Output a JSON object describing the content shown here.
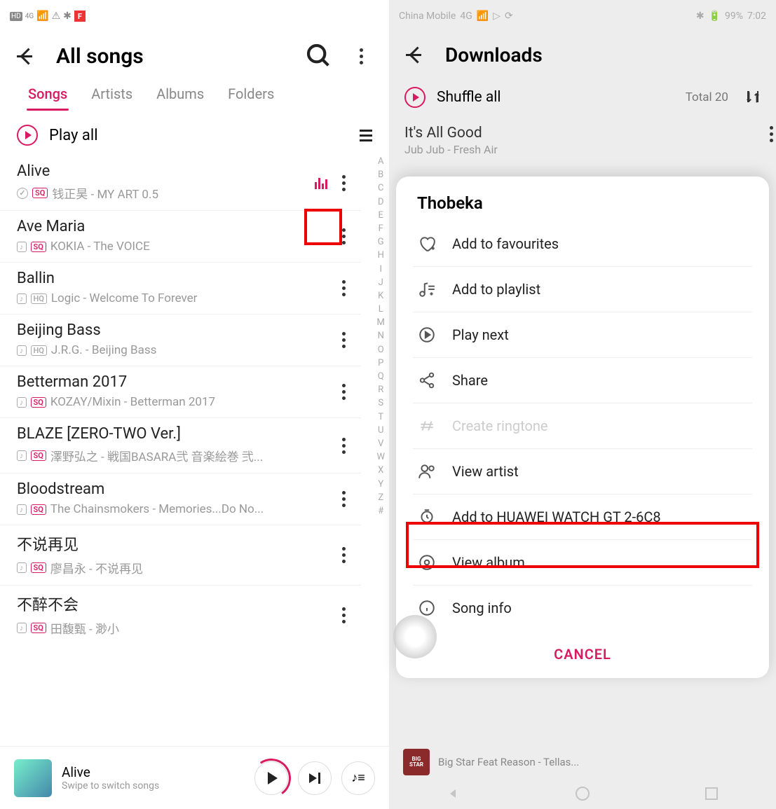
{
  "annotation": "Transport one song",
  "left": {
    "header_title": "All songs",
    "tabs": [
      "Songs",
      "Artists",
      "Albums",
      "Folders"
    ],
    "active_tab": 0,
    "play_all": "Play all",
    "index_letters": [
      "A",
      "B",
      "C",
      "D",
      "E",
      "F",
      "G",
      "H",
      "I",
      "J",
      "K",
      "L",
      "M",
      "N",
      "O",
      "P",
      "Q",
      "R",
      "S",
      "T",
      "U",
      "V",
      "W",
      "X",
      "Y",
      "Z",
      "#"
    ],
    "songs": [
      {
        "title": "Alive",
        "meta": "钱正昊 - MY ART 0.5",
        "badges": [
          "check",
          "sq"
        ],
        "playing": true
      },
      {
        "title": "Ave Maria",
        "meta": "KOKIA - The VOICE",
        "badges": [
          "note",
          "sq"
        ]
      },
      {
        "title": "Ballin",
        "meta": "Logic - Welcome To Forever",
        "badges": [
          "note",
          "hq"
        ]
      },
      {
        "title": "Beijing Bass",
        "meta": "J.R.G. - Beijing Bass",
        "badges": [
          "note",
          "hq"
        ]
      },
      {
        "title": "Betterman 2017",
        "meta": "KOZAY/Mixin - Betterman 2017",
        "badges": [
          "note",
          "sq"
        ]
      },
      {
        "title": "BLAZE [ZERO-TWO Ver.]",
        "meta": "澤野弘之 - 戦国BASARA弐 音楽絵巻 弐...",
        "badges": [
          "note",
          "sq"
        ]
      },
      {
        "title": "Bloodstream",
        "meta": "The Chainsmokers - Memories...Do No...",
        "badges": [
          "note",
          "sq"
        ]
      },
      {
        "title": "不说再见",
        "meta": "廖昌永 - 不说再见",
        "badges": [
          "note",
          "sq"
        ]
      },
      {
        "title": "不醉不会",
        "meta": "田馥甄 - 渺小",
        "badges": [
          "note",
          "sq"
        ]
      }
    ],
    "player": {
      "title": "Alive",
      "sub": "Swipe to switch songs"
    }
  },
  "right": {
    "status": {
      "carrier": "China Mobile",
      "battery": "99%",
      "time": "7:02"
    },
    "header_title": "Downloads",
    "shuffle": "Shuffle all",
    "total_label": "Total 20",
    "track": {
      "title": "It's All Good",
      "artist": "Jub Jub - Fresh Air"
    },
    "sheet_title": "Thobeka",
    "menu": [
      {
        "label": "Add to favourites",
        "icon": "heart"
      },
      {
        "label": "Add to playlist",
        "icon": "playlist"
      },
      {
        "label": "Play next",
        "icon": "playnext"
      },
      {
        "label": "Share",
        "icon": "share"
      },
      {
        "label": "Create ringtone",
        "icon": "ringtone",
        "disabled": true
      },
      {
        "label": "View artist",
        "icon": "artist"
      },
      {
        "label": "Add to HUAWEI WATCH GT 2-6C8",
        "icon": "watch"
      },
      {
        "label": "View album",
        "icon": "album"
      },
      {
        "label": "Song info",
        "icon": "info"
      }
    ],
    "cancel": "CANCEL",
    "mini_player": "Big Star Feat Reason - Tellas..."
  }
}
